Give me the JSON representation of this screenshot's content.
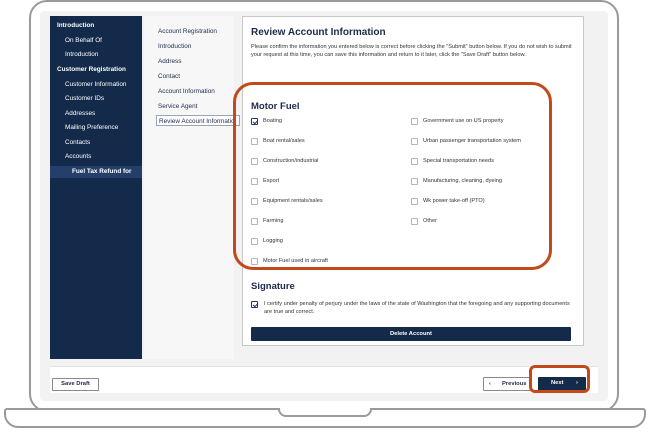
{
  "nav": {
    "items": [
      {
        "label": "Introduction",
        "bold": true
      },
      {
        "label": "On Behalf Of"
      },
      {
        "label": "Introduction"
      },
      {
        "label": "Customer Registration",
        "bold": true
      },
      {
        "label": "Customer Information"
      },
      {
        "label": "Customer IDs"
      },
      {
        "label": "Addresses"
      },
      {
        "label": "Mailing Preference"
      },
      {
        "label": "Contacts"
      },
      {
        "label": "Accounts"
      },
      {
        "label": "Fuel Tax Refund for"
      }
    ]
  },
  "subnav": {
    "items": [
      {
        "label": "Account Registration"
      },
      {
        "label": "Introduction"
      },
      {
        "label": "Address"
      },
      {
        "label": "Contact"
      },
      {
        "label": "Account Information"
      },
      {
        "label": "Service Agent"
      },
      {
        "label": "Review Account Informatio"
      }
    ]
  },
  "main": {
    "title": "Review Account Information",
    "description": "Please confirm the information you entered below is correct before clicking the \"Submit\" button below. If you do not wish to submit your request at this time, you can save this information and return to it later, click the \"Save Draft\" button below.",
    "motor_fuel": {
      "title": "Motor Fuel",
      "left_options": [
        {
          "label": "Boating",
          "checked": true
        },
        {
          "label": "Boat rental/sales",
          "checked": false
        },
        {
          "label": "Construction/industrial",
          "checked": false
        },
        {
          "label": "Export",
          "checked": false
        },
        {
          "label": "Equipment rentals/sales",
          "checked": false
        },
        {
          "label": "Farming",
          "checked": false
        },
        {
          "label": "Logging",
          "checked": false
        },
        {
          "label": "Motor Fuel used in aircraft",
          "checked": false
        }
      ],
      "right_options": [
        {
          "label": "Government use on US property",
          "checked": false
        },
        {
          "label": "Urban passenger transportation system",
          "checked": false
        },
        {
          "label": "Special transportation needs",
          "checked": false
        },
        {
          "label": "Manufacturing, cleaning, dyeing",
          "checked": false
        },
        {
          "label": "Wk power take-off (PTO)",
          "checked": false
        },
        {
          "label": "Other",
          "checked": false
        }
      ]
    },
    "signature": {
      "title": "Signature",
      "certify_text": "I certify under penalty of perjury under the laws of the state of Washington that the foregoing and any supporting documents are true and correct.",
      "checked": true
    },
    "delete_label": "Delete Account"
  },
  "footer": {
    "save_draft_label": "Save Draft",
    "previous_label": "Previous",
    "next_label": "Next",
    "previous_icon": "chevron-left-icon",
    "next_icon": "chevron-right-icon"
  },
  "colors": {
    "nav_bg": "#132a4a",
    "accent": "#132a4a",
    "highlight": "#c24a1a"
  }
}
